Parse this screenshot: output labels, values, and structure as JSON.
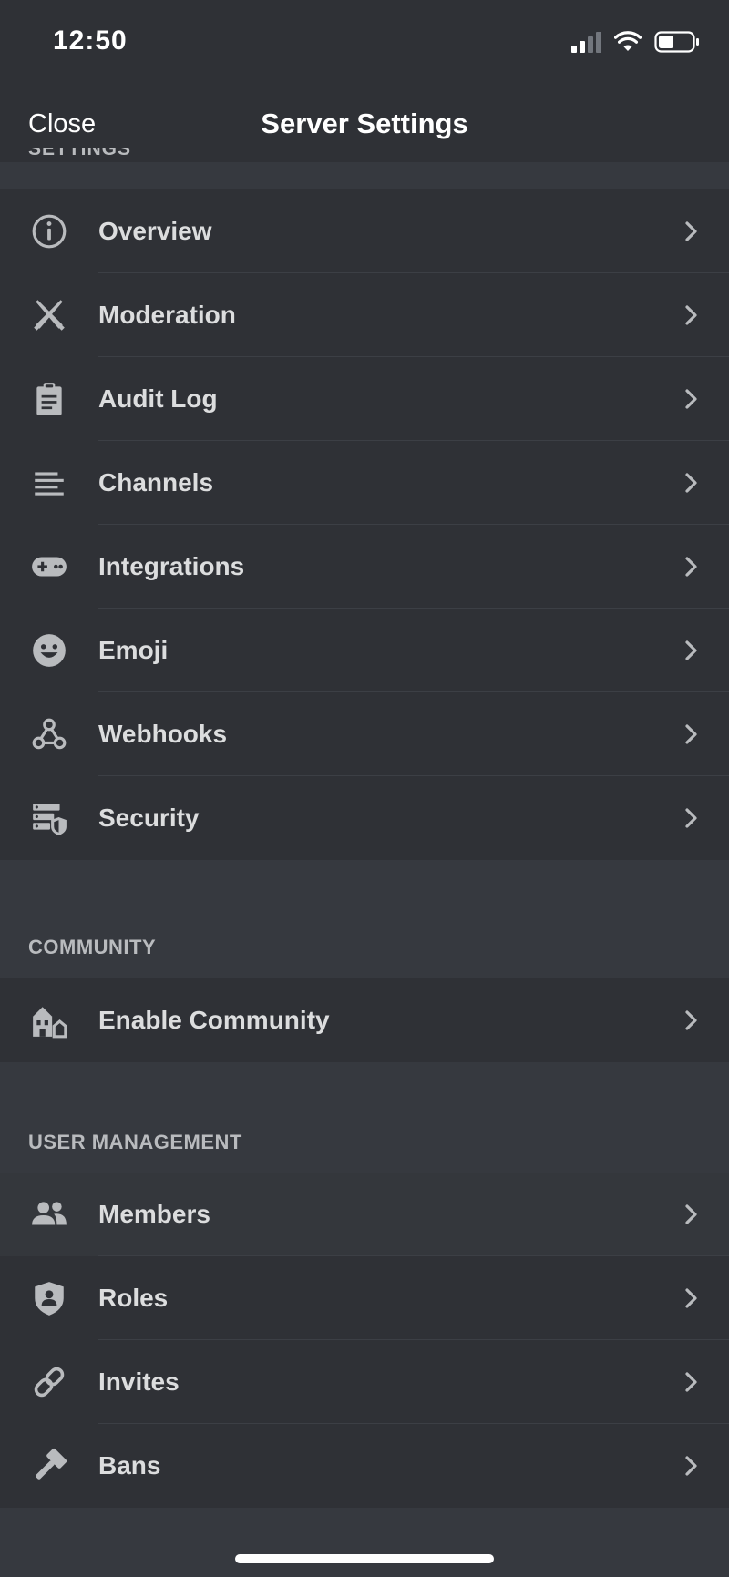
{
  "status_bar": {
    "time": "12:50"
  },
  "nav": {
    "close_label": "Close",
    "title": "Server Settings"
  },
  "sections": {
    "settings": {
      "header": "SETTINGS",
      "items": [
        {
          "label": "Overview",
          "icon": "info-icon"
        },
        {
          "label": "Moderation",
          "icon": "swords-icon"
        },
        {
          "label": "Audit Log",
          "icon": "clipboard-icon"
        },
        {
          "label": "Channels",
          "icon": "lines-icon"
        },
        {
          "label": "Integrations",
          "icon": "gamepad-icon"
        },
        {
          "label": "Emoji",
          "icon": "emoji-icon"
        },
        {
          "label": "Webhooks",
          "icon": "webhook-icon"
        },
        {
          "label": "Security",
          "icon": "server-shield-icon"
        }
      ]
    },
    "community": {
      "header": "COMMUNITY",
      "items": [
        {
          "label": "Enable Community",
          "icon": "community-icon"
        }
      ]
    },
    "user_management": {
      "header": "USER MANAGEMENT",
      "items": [
        {
          "label": "Members",
          "icon": "people-icon"
        },
        {
          "label": "Roles",
          "icon": "role-shield-icon"
        },
        {
          "label": "Invites",
          "icon": "link-icon"
        },
        {
          "label": "Bans",
          "icon": "hammer-icon"
        }
      ]
    }
  },
  "colors": {
    "background": "#36393f",
    "surface": "#2f3136",
    "text": "#dcddde",
    "muted": "#b9bbbe",
    "icon": "#b9bbbe"
  }
}
